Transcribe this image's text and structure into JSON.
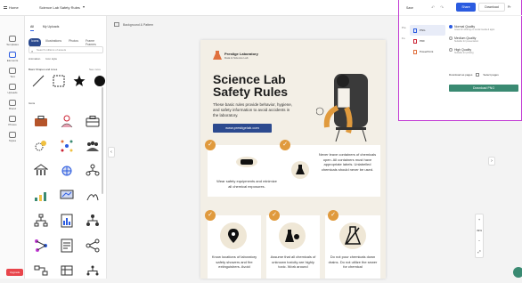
{
  "topbar": {
    "home": "Home",
    "doc_title": "Science Lab Safety Rules"
  },
  "rail": {
    "items": [
      "Templates",
      "Elements",
      "Text",
      "Uploads",
      "Brand",
      "Photos",
      "Styles"
    ],
    "upgrade": "Upgrade"
  },
  "panel": {
    "tabs": [
      "All",
      "My Uploads"
    ],
    "chips": [
      "Icons",
      "Illustrations",
      "Photos",
      "Frame Frames"
    ],
    "search_placeholder": "Search millions of assets",
    "filters": [
      "Animation",
      "Icon style"
    ],
    "basic_section": "Basic Shapes and Lines",
    "see_all": "See more",
    "icons_section": "Icons"
  },
  "canvas": {
    "background_label": "Background & Pattern"
  },
  "poster": {
    "logo_name": "Prestige Laboratory",
    "logo_sub": "Data & Science Lab",
    "title_line1": "Science Lab",
    "title_line2": "Safety Rules",
    "intro": "These basic rules provide behavior, hygiene, and safety information to avoid accidents in the laboratory.",
    "url": "www.prestigelab.com",
    "rule1": "Wear safety equipments and minimize all chemical exposures.",
    "rule2": "Never leave containers of chemicals open. All containers must have appropriate labels. Unlabelled chemicals should never be used.",
    "rule3": "Know locations of laboratory safety showers and fire extinguishers. Avoid",
    "rule4": "Assume that all chemicals of unknown toxicity are highly toxic. Work around",
    "rule5": "Do not pour chemicals down drains. Do not utilize the sewer for chemical"
  },
  "share": {
    "save": "Save",
    "share_btn": "Share",
    "download_btn": "Download",
    "print_btn": "Pr",
    "side": [
      "Pre",
      "Fo"
    ],
    "formats": [
      "PNG",
      "PDF",
      "PowerPoint"
    ],
    "qualities": [
      {
        "label": "Normal Quality",
        "desc": "Great for sharing on social media & apps"
      },
      {
        "label": "Medium Quality",
        "desc": "Suitable for presentation"
      },
      {
        "label": "High Quality",
        "desc": "Suitable for printing"
      }
    ],
    "pages_label": "Download as pages",
    "pages_option": "Select pages",
    "download_final": "Download PNG"
  },
  "zoom": {
    "plus": "+",
    "level": "39%",
    "minus": "−"
  },
  "colors": {
    "accent": "#2b5be0",
    "badge": "#e09a3d",
    "navy": "#2c4a8f",
    "highlight_border": "#c23bd4"
  }
}
